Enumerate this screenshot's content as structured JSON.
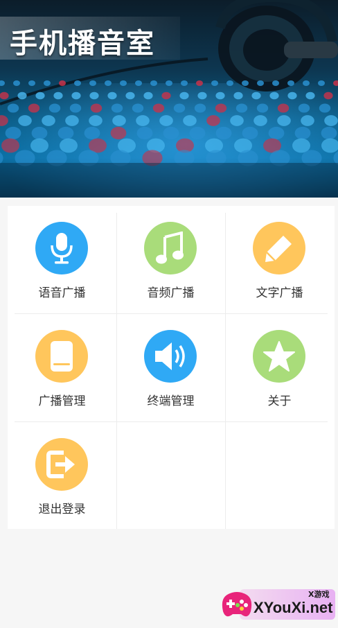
{
  "banner": {
    "title": "手机播音室"
  },
  "menu": {
    "items": [
      {
        "label": "语音广播",
        "icon": "microphone-icon",
        "color": "#2fa9f5"
      },
      {
        "label": "音频广播",
        "icon": "music-note-icon",
        "color": "#a9dc7a"
      },
      {
        "label": "文字广播",
        "icon": "pencil-icon",
        "color": "#ffc65c"
      },
      {
        "label": "广播管理",
        "icon": "device-icon",
        "color": "#ffc65c"
      },
      {
        "label": "终端管理",
        "icon": "speaker-icon",
        "color": "#2fa9f5"
      },
      {
        "label": "关于",
        "icon": "star-icon",
        "color": "#a9dc7a"
      },
      {
        "label": "退出登录",
        "icon": "logout-icon",
        "color": "#ffc65c"
      }
    ]
  },
  "watermark": {
    "site": "XYouXi.net",
    "tag": "X游戏",
    "icon": "gamepad-icon"
  }
}
